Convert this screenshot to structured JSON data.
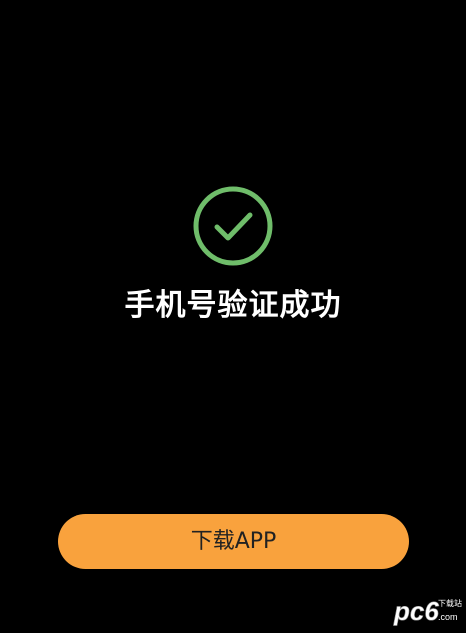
{
  "success": {
    "icon": "check-circle-icon",
    "title": "手机号验证成功",
    "color": "#6fbd6a"
  },
  "actions": {
    "download_label": "下载APP",
    "accent": "#f9a23d"
  },
  "watermark": {
    "text": "pc6",
    "sub": "下载站",
    "suffix": ".com"
  }
}
